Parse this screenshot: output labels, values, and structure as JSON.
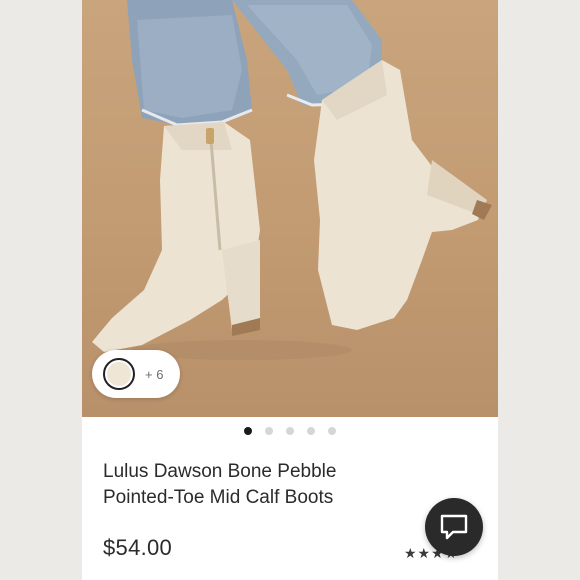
{
  "product": {
    "title_line1": "Lulus Dawson Bone Pebble",
    "title_line2": "Pointed-Toe Mid Calf Boots",
    "price": "$54.00",
    "rating_display": "★★★★",
    "image_alt": "Lulus Dawson Bone Pebble Pointed-Toe Mid Calf Boots"
  },
  "swatches": {
    "selected_color": "#efe6d6",
    "more_label": "+ 6"
  },
  "carousel": {
    "total_images": 5,
    "active_index": 0
  },
  "chat": {
    "icon": "chat-icon"
  },
  "colors": {
    "background_photo": "#c29b72",
    "boot": "#ece3d3",
    "accent_dark": "#2a2a2a"
  }
}
